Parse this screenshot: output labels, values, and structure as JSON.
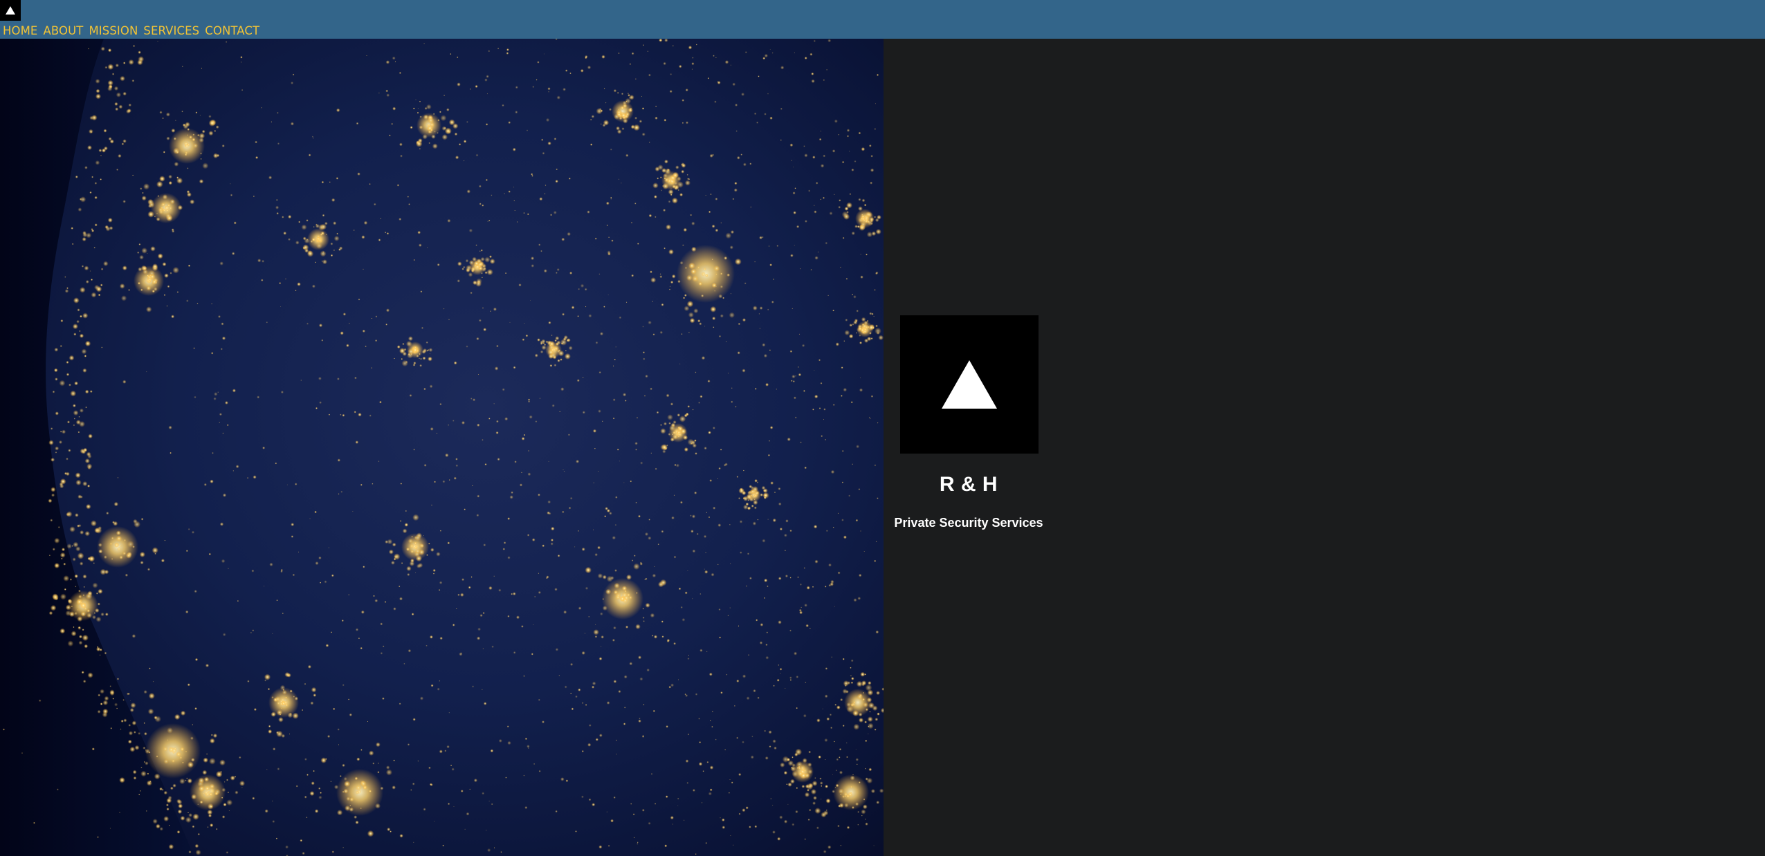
{
  "header": {
    "logo_icon": "triangle-icon",
    "colors": {
      "bar": "#33658a",
      "link": "#f2c335"
    }
  },
  "nav": {
    "items": [
      {
        "label": "HOME"
      },
      {
        "label": "ABOUT"
      },
      {
        "label": "MISSION"
      },
      {
        "label": "SERVICES"
      },
      {
        "label": "CONTACT"
      }
    ]
  },
  "hero": {
    "image_subject": "night-lights satellite map"
  },
  "brand": {
    "logo_icon": "triangle-icon",
    "name": "R & H",
    "tagline": "Private Security Services",
    "colors": {
      "panel": "#1b1c1d",
      "text": "#ffffff"
    }
  }
}
